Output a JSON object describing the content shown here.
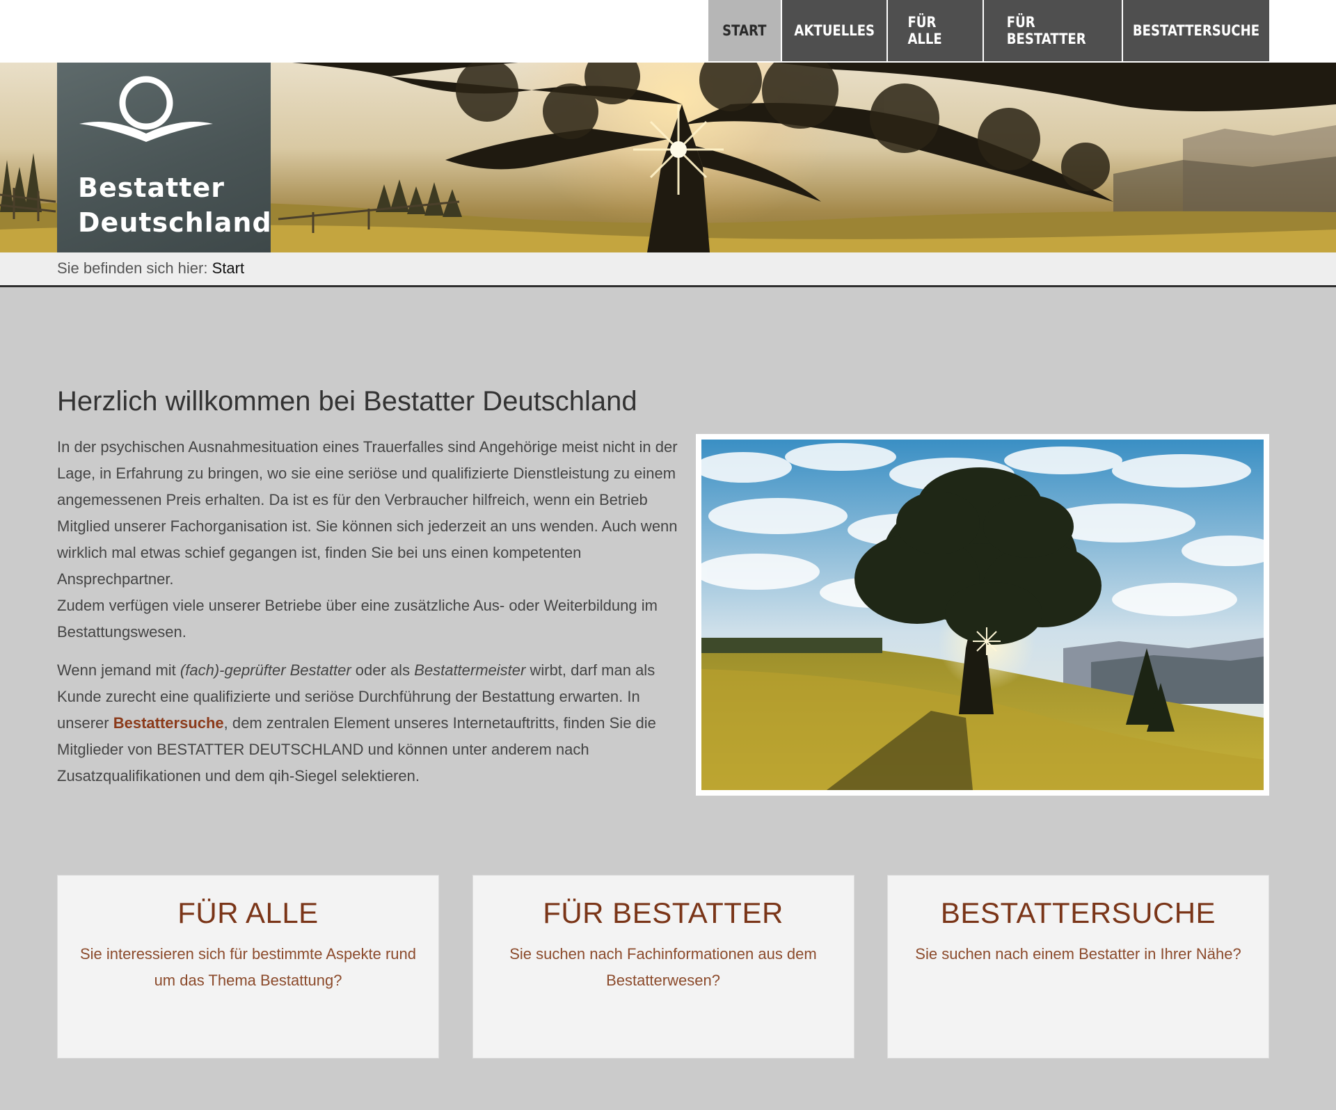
{
  "nav": {
    "items": [
      {
        "label": "START",
        "active": true
      },
      {
        "label": "AKTUELLES",
        "active": false
      },
      {
        "label": "FÜR ALLE",
        "active": false
      },
      {
        "label": "FÜR BESTATTER",
        "active": false
      },
      {
        "label": "BESTATTERSUCHE",
        "active": false
      }
    ]
  },
  "logo": {
    "line1": "Bestatter",
    "line2": "Deutschland"
  },
  "breadcrumb": {
    "prefix": "Sie befinden sich hier:",
    "current": "Start"
  },
  "main": {
    "title": "Herzlich willkommen bei Bestatter Deutschland",
    "para1_line1": "In der psychischen Ausnahmesituation eines Trauerfalles sind Angehörige meist nicht in der Lage, in Erfahrung zu bringen, wo sie eine seriöse und qualifizierte Dienstleistung zu einem angemessenen Preis erhalten. Da ist es für den Verbraucher hilfreich, wenn ein Betrieb Mitglied unserer Fachorganisation ist. Sie können sich jederzeit an uns wenden. Auch wenn wirklich mal etwas schief gegangen ist, finden Sie bei uns einen kompetenten Ansprechpartner.",
    "para1_line2": "Zudem verfügen viele unserer Betriebe über eine zusätzliche Aus- oder Weiterbildung im Bestattungswesen.",
    "para2_a": "Wenn jemand mit ",
    "para2_em1": "(fach)-geprüfter Bestatter",
    "para2_b": " oder als ",
    "para2_em2": "Bestattermeister",
    "para2_c": " wirbt, darf man als Kunde zurecht eine qualifizierte und seriöse Durchführung der Bestattung erwarten. In unserer ",
    "para2_link": "Bestattersuche",
    "para2_d": ", dem zentralen Element unseres Internetauftritts, finden Sie die Mitglieder von BESTATTER DEUTSCHLAND und können unter anderem nach Zusatzqualifikationen und dem qih-Siegel selektieren."
  },
  "cards": [
    {
      "title": "FÜR ALLE",
      "text": "Sie interessieren sich für bestimmte Aspekte rund um das Thema Bestattung?"
    },
    {
      "title": "FÜR BESTATTER",
      "text": "Sie suchen nach Fachinformationen aus dem Bestatterwesen?"
    },
    {
      "title": "BESTATTERSUCHE",
      "text": "Sie suchen nach einem Bestatter in Ihrer Nähe?"
    }
  ],
  "colors": {
    "accent": "#7a3518",
    "nav_bg": "#4f4f4f",
    "nav_active_bg": "#b6b6b6",
    "page_bg": "#cbcbcb"
  }
}
